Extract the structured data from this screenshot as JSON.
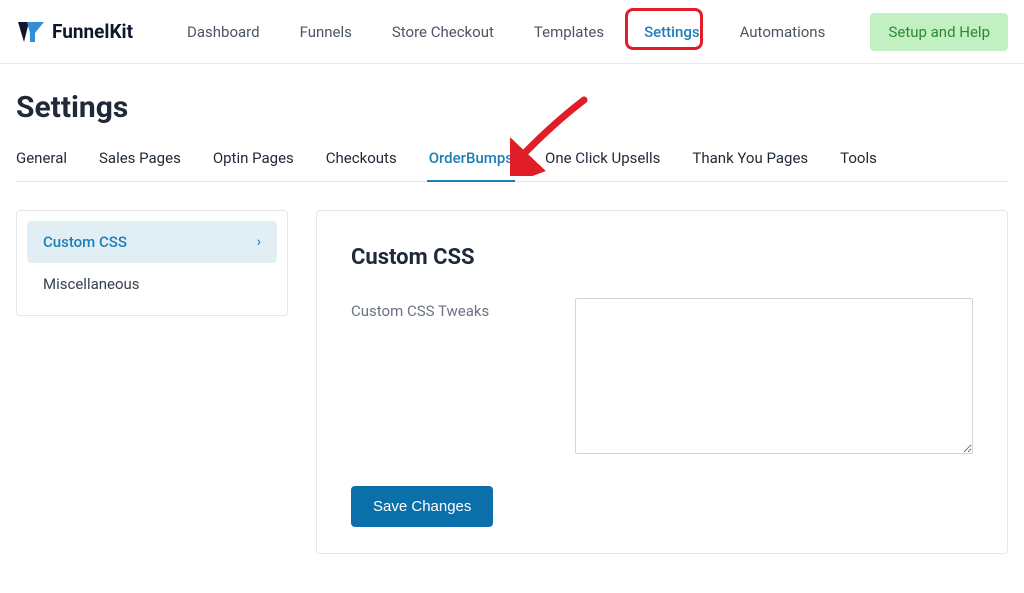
{
  "brand": {
    "name_part1": "Funnel",
    "name_part2": "Kit"
  },
  "topnav": {
    "items": [
      {
        "label": "Dashboard"
      },
      {
        "label": "Funnels"
      },
      {
        "label": "Store Checkout"
      },
      {
        "label": "Templates"
      },
      {
        "label": "Settings"
      },
      {
        "label": "Automations"
      }
    ],
    "setup_help": "Setup and Help"
  },
  "page": {
    "title": "Settings"
  },
  "subtabs": {
    "items": [
      {
        "label": "General"
      },
      {
        "label": "Sales Pages"
      },
      {
        "label": "Optin Pages"
      },
      {
        "label": "Checkouts"
      },
      {
        "label": "OrderBumps"
      },
      {
        "label": "One Click Upsells"
      },
      {
        "label": "Thank You Pages"
      },
      {
        "label": "Tools"
      }
    ]
  },
  "sidebar": {
    "items": [
      {
        "label": "Custom CSS"
      },
      {
        "label": "Miscellaneous"
      }
    ]
  },
  "panel": {
    "heading": "Custom CSS",
    "field_label": "Custom CSS Tweaks",
    "textarea_value": "",
    "save_label": "Save Changes"
  }
}
